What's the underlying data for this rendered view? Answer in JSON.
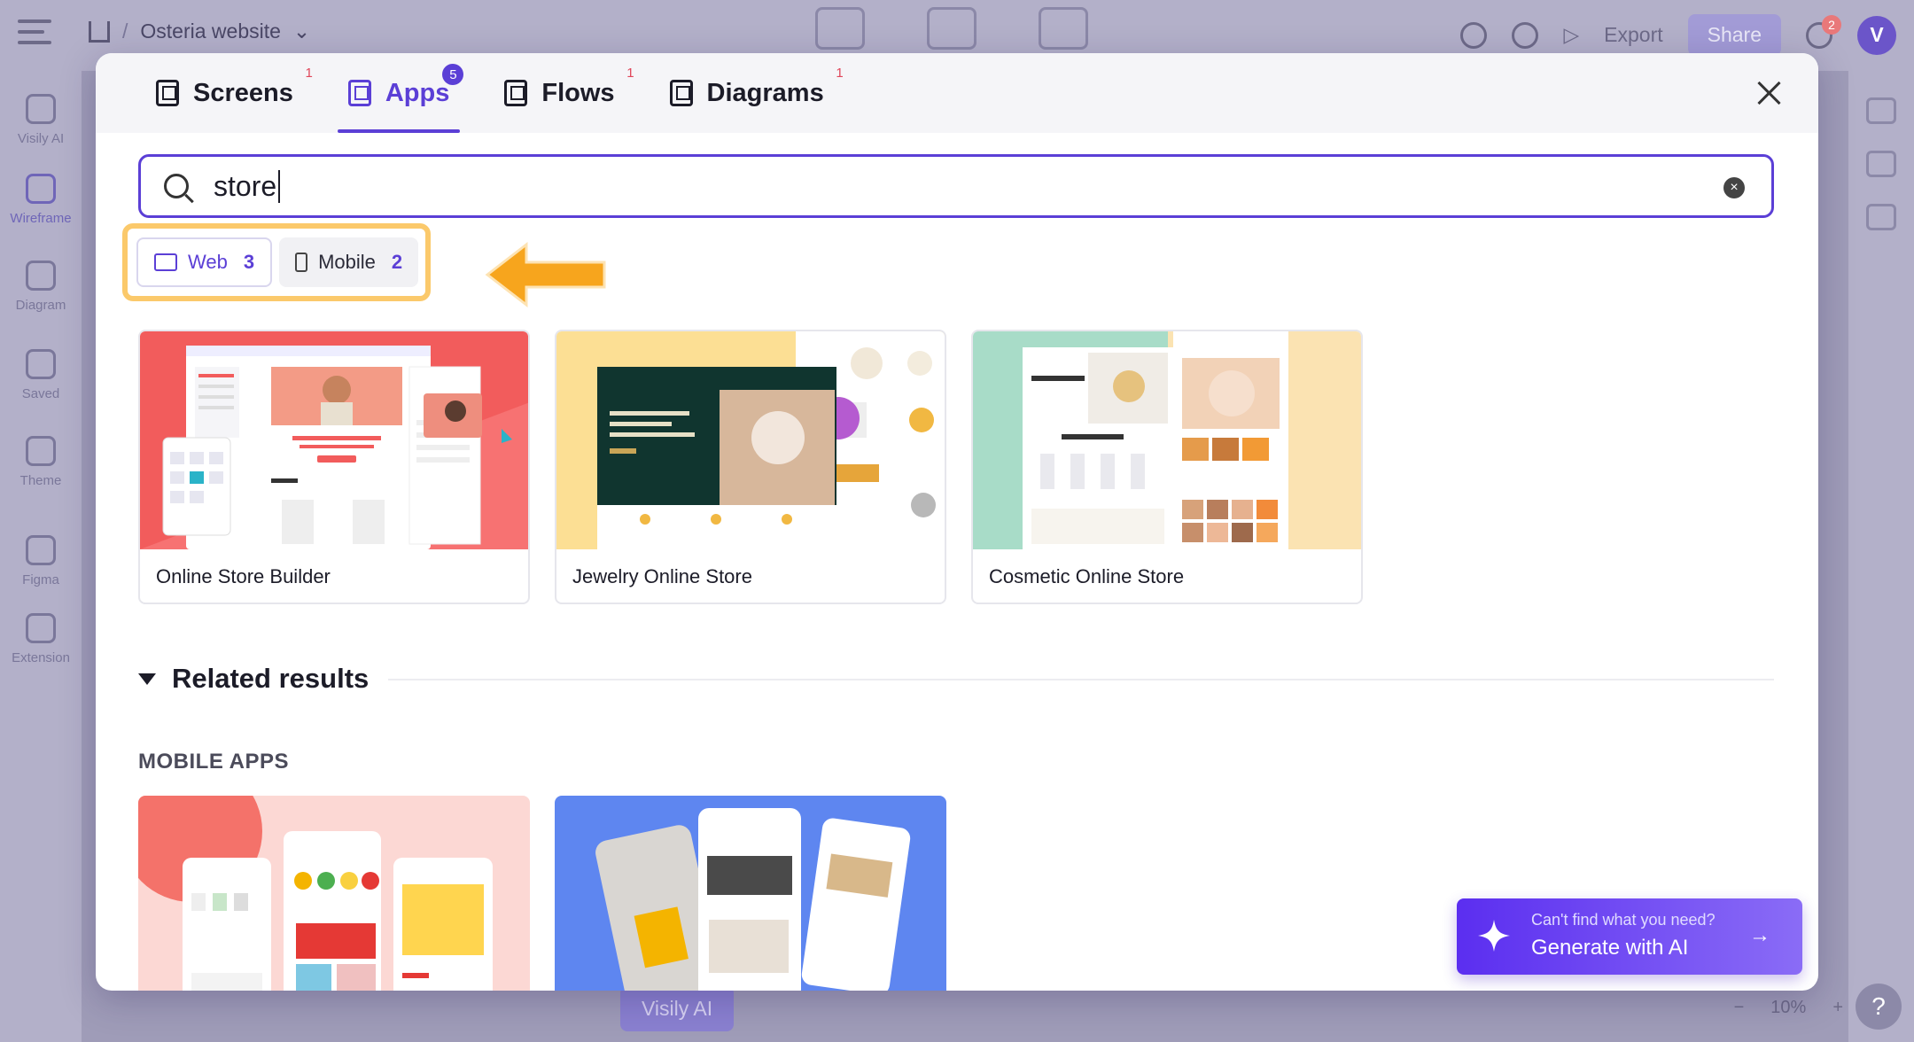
{
  "app": {
    "project_name": "Osteria website",
    "left_nav": [
      "Visily AI",
      "Wireframe",
      "Diagram",
      "Saved",
      "Theme",
      "Figma",
      "Extension"
    ],
    "top_right": {
      "export_label": "Export",
      "share_label": "Share",
      "notification_count": "2",
      "avatar_letter": "V"
    },
    "bottom_ai_label": "Visily AI",
    "zoom_level": "10%"
  },
  "modal": {
    "tabs": [
      {
        "label": "Screens",
        "badge": "1"
      },
      {
        "label": "Apps",
        "badge": "5"
      },
      {
        "label": "Flows",
        "badge": "1"
      },
      {
        "label": "Diagrams",
        "badge": "1"
      }
    ],
    "search": {
      "value": "store"
    },
    "filters": [
      {
        "label": "Web",
        "count": "3"
      },
      {
        "label": "Mobile",
        "count": "2"
      }
    ],
    "results": [
      {
        "title": "Online Store Builder"
      },
      {
        "title": "Jewelry Online Store"
      },
      {
        "title": "Cosmetic Online Store"
      }
    ],
    "related": {
      "title": "Related results",
      "subsection": "MOBILE APPS"
    },
    "generate": {
      "hint": "Can't find what you need?",
      "label": "Generate with AI"
    }
  },
  "colors": {
    "accent": "#5b3fd6",
    "highlight": "#fbc96b",
    "arrow": "#f7a51d"
  }
}
